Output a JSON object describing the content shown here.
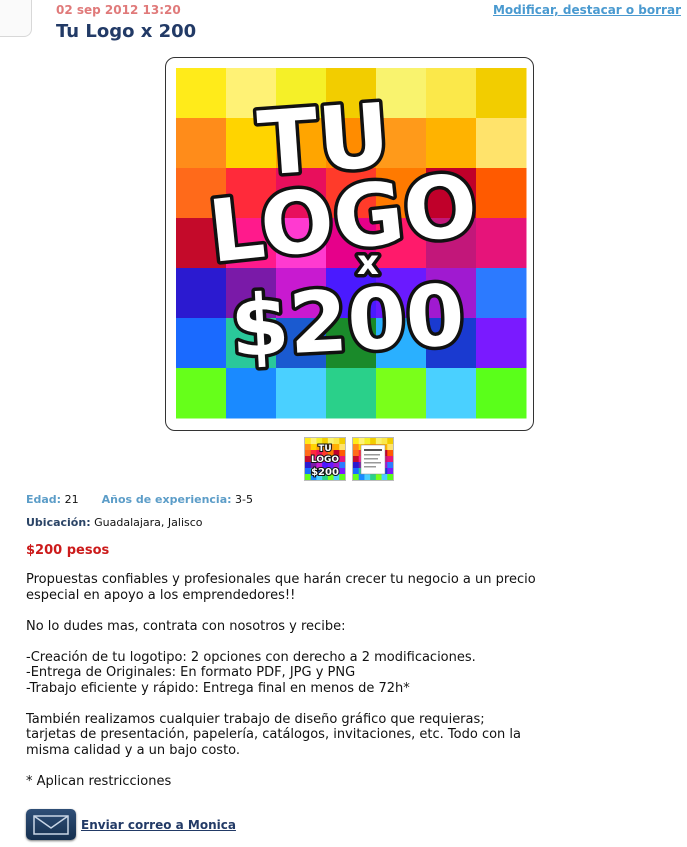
{
  "post": {
    "date": "02 sep 2012 13:20",
    "edit_link": "Modificar, destacar o borrar",
    "title": "Tu Logo x 200"
  },
  "image_text": {
    "line1": "TU",
    "line2": "LOGO",
    "line3": "x",
    "line4": "$200"
  },
  "thumbnails": {
    "thumb1_text": "TU LOGO $200"
  },
  "details": {
    "age_label": "Edad:",
    "age_value": "21",
    "experience_label": "Años de experiencia:",
    "experience_value": "3-5",
    "location_label": "Ubicación:",
    "location_value": "Guadalajara, Jalisco"
  },
  "price": "$200 pesos",
  "description": {
    "intro": "Propuestas confiables y profesionales que harán crecer tu negocio a un precio especial en apoyo a los emprendedores!!",
    "call": "No lo dudes mas, contrata con nosotros y recibe:",
    "items": [
      "-Creación de tu logotipo: 2 opciones con derecho a 2 modificaciones.",
      "-Entrega de Originales: En formato PDF, JPG y PNG",
      "-Trabajo eficiente y rápido: Entrega final en menos de 72h*"
    ],
    "extra": "También realizamos cualquier trabajo de diseño gráfico que requieras; tarjetas de presentación, papelería, catálogos, invitaciones, etc. Todo con la misma calidad y a un bajo costo.",
    "note": "* Aplican restricciones"
  },
  "contact": {
    "link": "Enviar correo a Monica",
    "icon": "envelope-icon"
  }
}
